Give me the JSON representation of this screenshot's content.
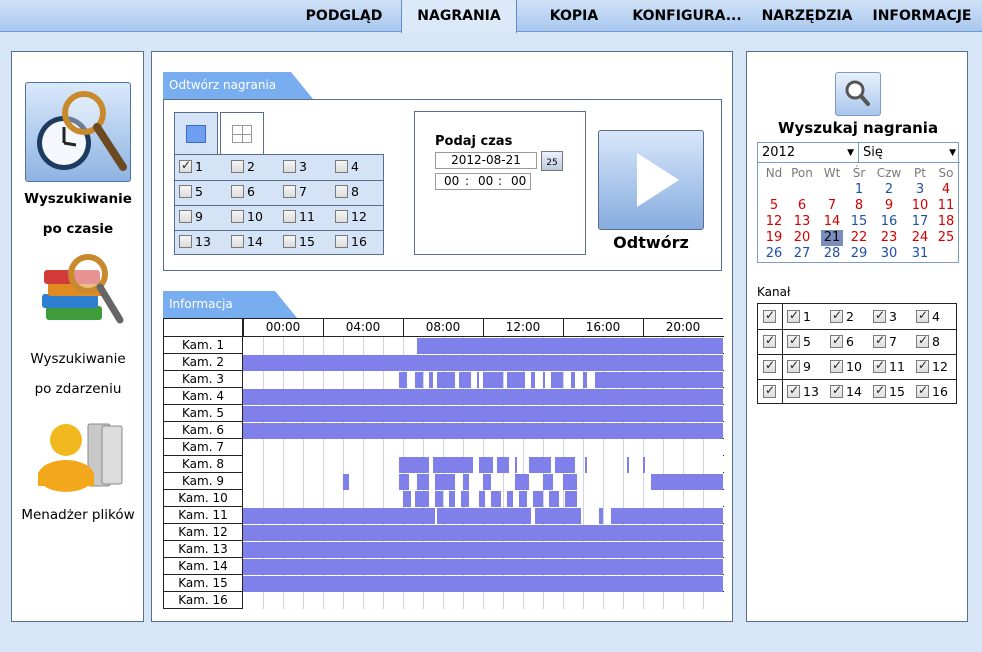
{
  "tabs": [
    {
      "label": "PODGLĄD",
      "active": false
    },
    {
      "label": "NAGRANIA",
      "active": true
    },
    {
      "label": "KOPIA",
      "active": false
    },
    {
      "label": "KONFIGURA...",
      "active": false
    },
    {
      "label": "NARZĘDZIA",
      "active": false
    },
    {
      "label": "INFORMACJE",
      "active": false
    }
  ],
  "left_menu": {
    "time_search": {
      "line1": "Wyszukiwanie",
      "line2": "po czasie",
      "icon": "clock-magnifier-icon"
    },
    "event_search": {
      "line1": "Wyszukiwanie",
      "line2": "po zdarzeniu",
      "icon": "books-magnifier-icon"
    },
    "file_manager": {
      "label": "Menadżer plików",
      "icon": "user-files-icon"
    }
  },
  "playback": {
    "section_title": "Odtwórz nagrania",
    "layout_icons": [
      "single-view-icon",
      "quad-view-icon"
    ],
    "channels": [
      {
        "n": "1",
        "checked": true
      },
      {
        "n": "2",
        "checked": false
      },
      {
        "n": "3",
        "checked": false
      },
      {
        "n": "4",
        "checked": false
      },
      {
        "n": "5",
        "checked": false
      },
      {
        "n": "6",
        "checked": false
      },
      {
        "n": "7",
        "checked": false
      },
      {
        "n": "8",
        "checked": false
      },
      {
        "n": "9",
        "checked": false
      },
      {
        "n": "10",
        "checked": false
      },
      {
        "n": "11",
        "checked": false
      },
      {
        "n": "12",
        "checked": false
      },
      {
        "n": "13",
        "checked": false
      },
      {
        "n": "14",
        "checked": false
      },
      {
        "n": "15",
        "checked": false
      },
      {
        "n": "16",
        "checked": false
      }
    ],
    "time_label": "Podaj czas",
    "date_value": "2012-08-21",
    "calendar_icon_text": "25",
    "hour": "00",
    "minute": "00",
    "second": "00",
    "sep": ":",
    "play_label": "Odtwórz"
  },
  "info": {
    "section_title": "Informacja",
    "hours": [
      "00:00",
      "04:00",
      "08:00",
      "12:00",
      "16:00",
      "20:00"
    ],
    "cameras": [
      {
        "name": "Kam. 1",
        "segments": [
          [
            8.7,
            24
          ]
        ]
      },
      {
        "name": "Kam. 2",
        "segments": [
          [
            0,
            24
          ]
        ]
      },
      {
        "name": "Kam. 3",
        "segments": [
          [
            7.8,
            8.2
          ],
          [
            8.6,
            9.0
          ],
          [
            9.3,
            9.5
          ],
          [
            9.7,
            10.6
          ],
          [
            10.8,
            11.4
          ],
          [
            11.7,
            11.8
          ],
          [
            12.0,
            13.0
          ],
          [
            13.2,
            14.1
          ],
          [
            14.4,
            14.6
          ],
          [
            15.0,
            15.1
          ],
          [
            15.4,
            16.0
          ],
          [
            16.4,
            16.6
          ],
          [
            17.0,
            17.2
          ],
          [
            17.6,
            24
          ]
        ]
      },
      {
        "name": "Kam. 4",
        "segments": [
          [
            0,
            24
          ]
        ]
      },
      {
        "name": "Kam. 5",
        "segments": [
          [
            0,
            24
          ]
        ]
      },
      {
        "name": "Kam. 6",
        "segments": [
          [
            0,
            24
          ]
        ]
      },
      {
        "name": "Kam. 7",
        "segments": []
      },
      {
        "name": "Kam. 8",
        "segments": [
          [
            7.8,
            9.3
          ],
          [
            9.5,
            11.5
          ],
          [
            11.8,
            12.5
          ],
          [
            12.7,
            13.3
          ],
          [
            13.6,
            13.7
          ],
          [
            14.3,
            15.4
          ],
          [
            15.6,
            16.6
          ],
          [
            17.1,
            17.2
          ],
          [
            19.2,
            19.3
          ],
          [
            20.0,
            20.1
          ]
        ]
      },
      {
        "name": "Kam. 9",
        "segments": [
          [
            5.0,
            5.3
          ],
          [
            7.8,
            8.3
          ],
          [
            8.7,
            9.3
          ],
          [
            9.6,
            10.6
          ],
          [
            11.0,
            11.3
          ],
          [
            12.0,
            12.4
          ],
          [
            13.6,
            14.3
          ],
          [
            15.0,
            15.5
          ],
          [
            16.0,
            16.7
          ],
          [
            20.4,
            24
          ]
        ]
      },
      {
        "name": "Kam. 10",
        "segments": [
          [
            8.0,
            8.4
          ],
          [
            8.6,
            9.3
          ],
          [
            9.6,
            10.0
          ],
          [
            10.3,
            10.6
          ],
          [
            10.9,
            11.3
          ],
          [
            11.8,
            12.1
          ],
          [
            12.4,
            12.9
          ],
          [
            13.2,
            13.5
          ],
          [
            13.8,
            14.2
          ],
          [
            14.5,
            15.0
          ],
          [
            15.3,
            15.8
          ],
          [
            16.1,
            16.7
          ]
        ]
      },
      {
        "name": "Kam. 11",
        "segments": [
          [
            0,
            9.6
          ],
          [
            9.7,
            14.4
          ],
          [
            14.6,
            16.9
          ],
          [
            17.8,
            18.0
          ],
          [
            18.4,
            24
          ]
        ]
      },
      {
        "name": "Kam. 12",
        "segments": [
          [
            0,
            24
          ]
        ]
      },
      {
        "name": "Kam. 13",
        "segments": [
          [
            0,
            24
          ]
        ]
      },
      {
        "name": "Kam. 14",
        "segments": [
          [
            0,
            24
          ]
        ]
      },
      {
        "name": "Kam. 15",
        "segments": [
          [
            0,
            24
          ]
        ]
      },
      {
        "name": "Kam. 16",
        "segments": []
      }
    ]
  },
  "search": {
    "icon": "search-magnifier-icon",
    "title": "Wyszukaj nagrania",
    "year": "2012",
    "month": "Się",
    "weekdays": [
      "Nd",
      "Pon",
      "Wt",
      "Śr",
      "Czw",
      "Pt",
      "So"
    ],
    "weeks": [
      [
        "",
        "",
        "",
        "1",
        "2",
        "3",
        "4"
      ],
      [
        "5",
        "6",
        "7",
        "8",
        "9",
        "10",
        "11"
      ],
      [
        "12",
        "13",
        "14",
        "15",
        "16",
        "17",
        "18"
      ],
      [
        "19",
        "20",
        "21",
        "22",
        "23",
        "24",
        "25"
      ],
      [
        "26",
        "27",
        "28",
        "29",
        "30",
        "31",
        ""
      ]
    ],
    "selected_day": "21",
    "channel_label": "Kanał",
    "channels": [
      "1",
      "2",
      "3",
      "4",
      "5",
      "6",
      "7",
      "8",
      "9",
      "10",
      "11",
      "12",
      "13",
      "14",
      "15",
      "16"
    ]
  },
  "colors": {
    "record_bar": "#8080ea",
    "accent": "#78aef0",
    "red_day": "#d40000",
    "blue_day": "#1f4fa8"
  }
}
